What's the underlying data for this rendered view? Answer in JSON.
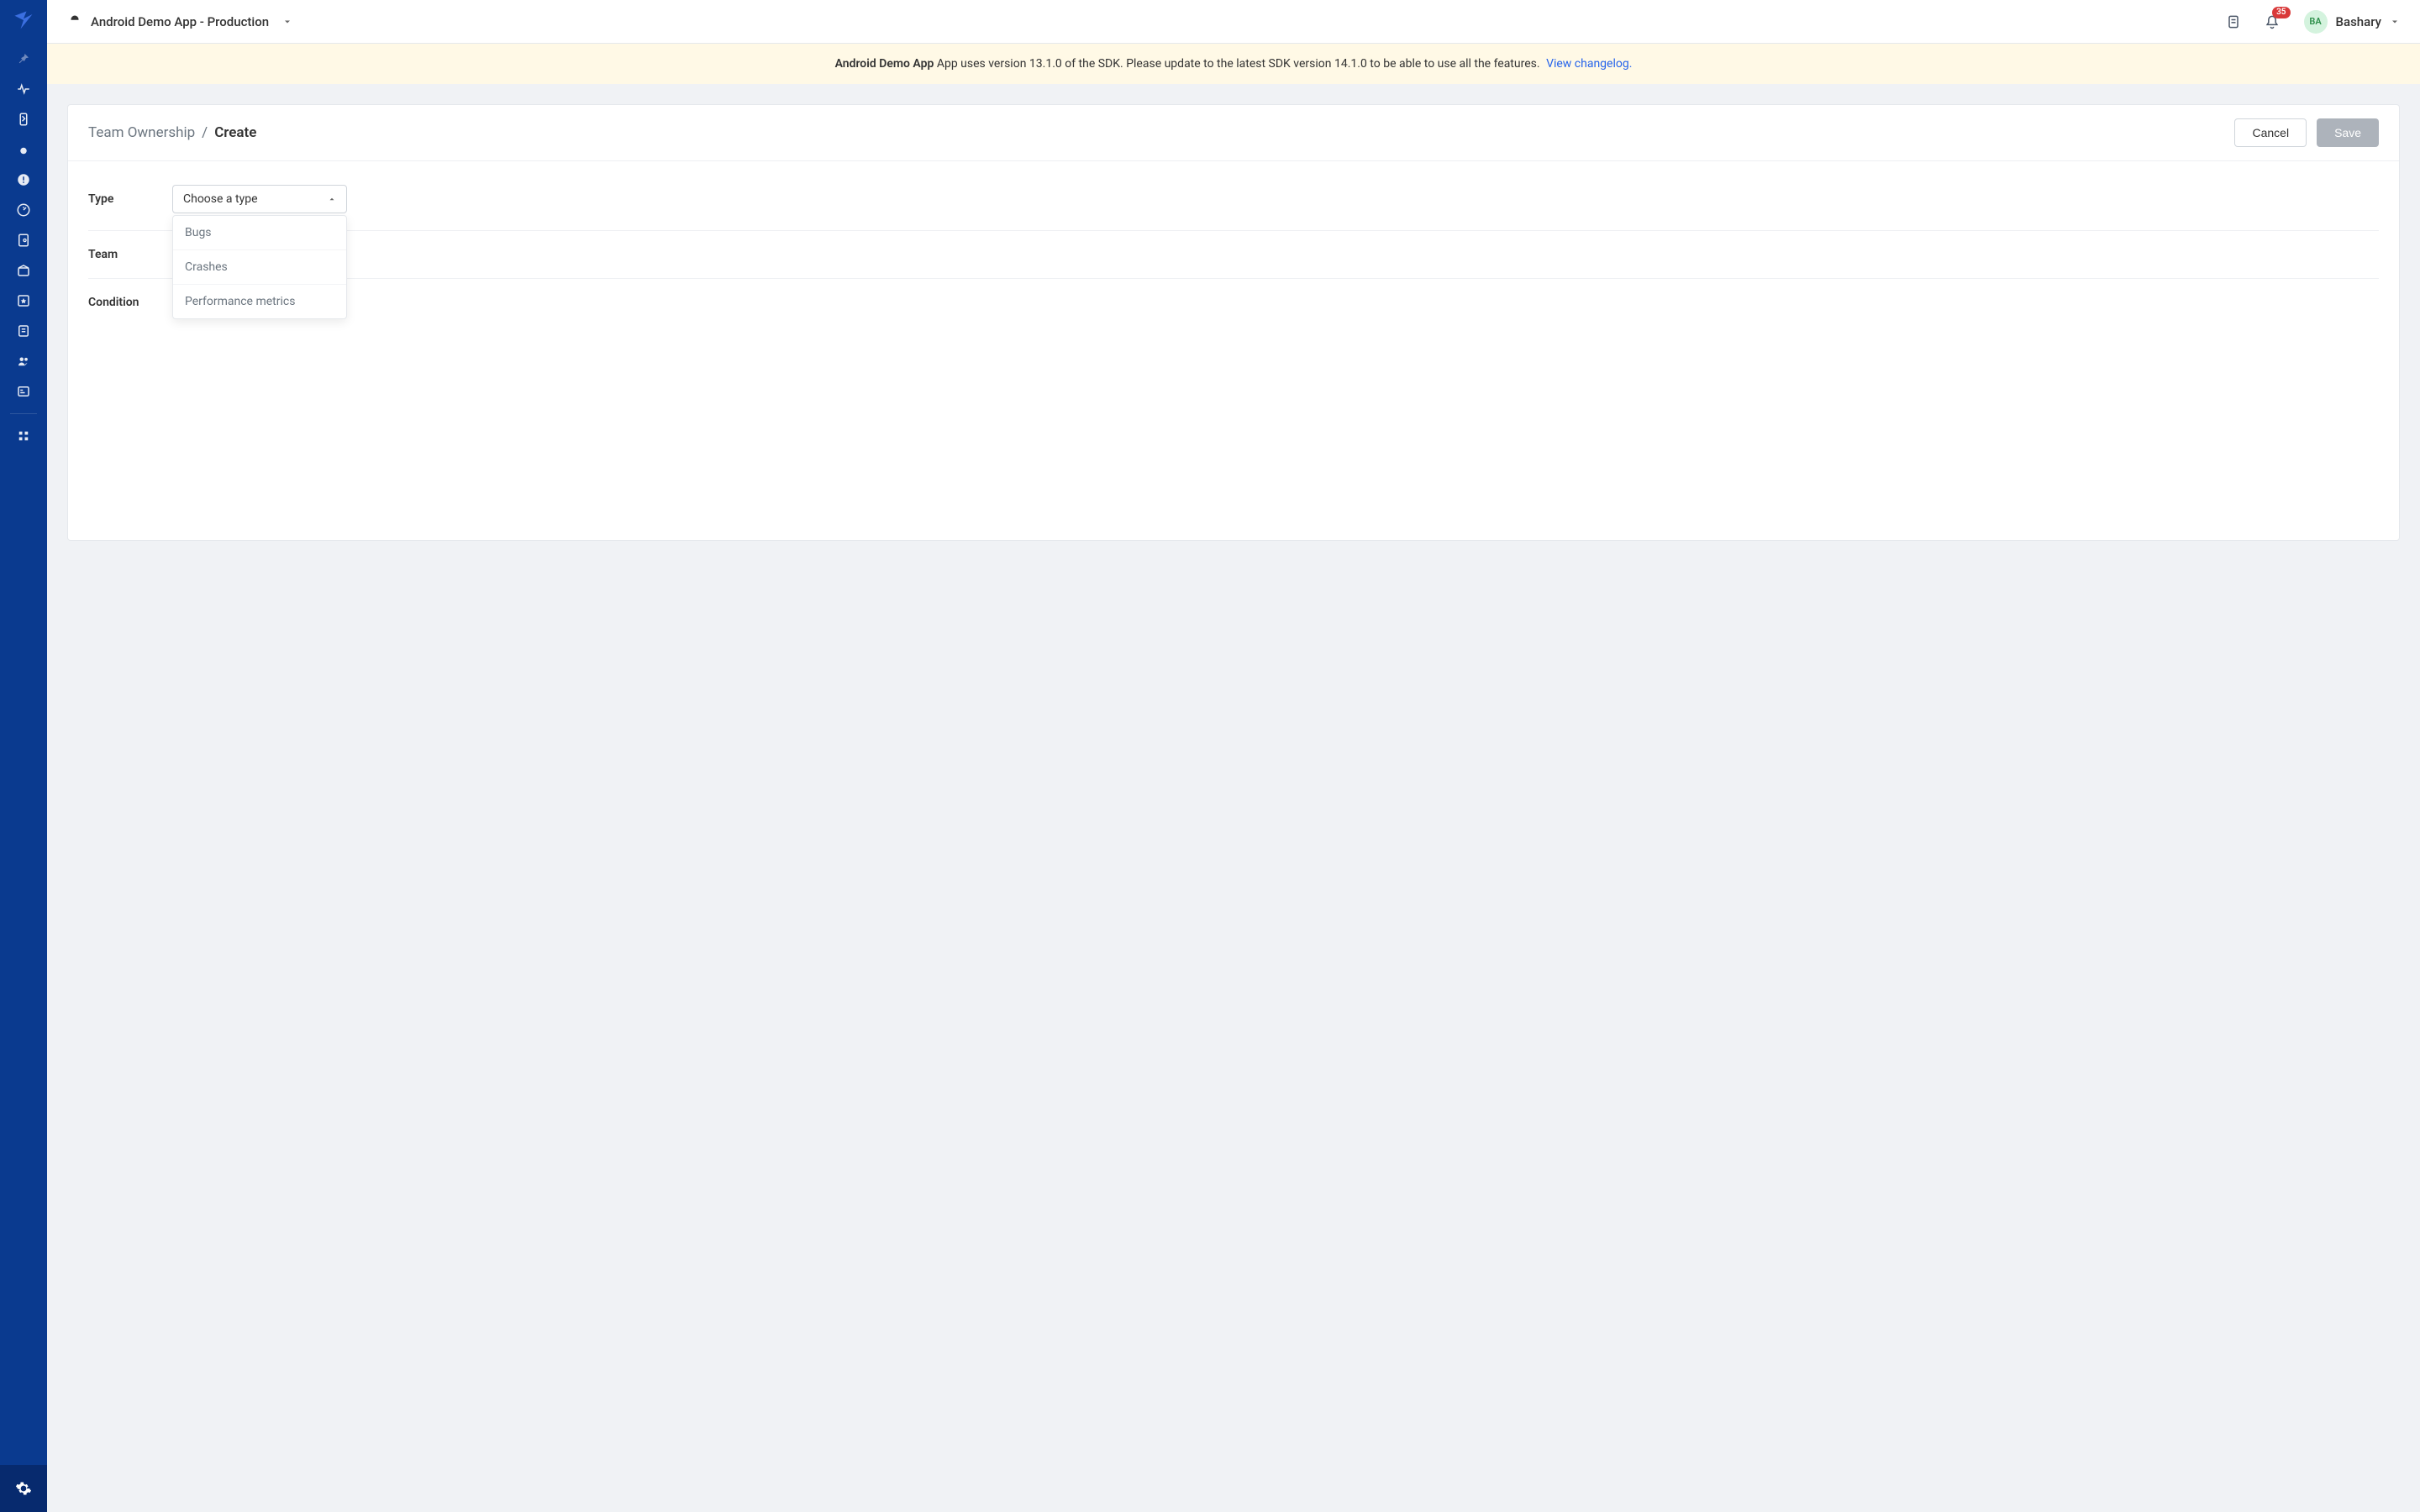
{
  "header": {
    "app_name": "Android Demo App - Production",
    "notification_count": "35",
    "user_initials": "BA",
    "user_name": "Bashary"
  },
  "banner": {
    "app_bold": "Android Demo App",
    "text": " App uses version 13.1.0 of the SDK. Please update to the latest SDK version 14.1.0 to be able to use all the features.",
    "link_text": "View changelog."
  },
  "breadcrumb": {
    "root": "Team Ownership",
    "sep": "/",
    "current": "Create"
  },
  "actions": {
    "cancel": "Cancel",
    "save": "Save"
  },
  "form": {
    "type_label": "Type",
    "team_label": "Team",
    "condition_label": "Condition",
    "type_placeholder": "Choose a type",
    "type_options": [
      "Bugs",
      "Crashes",
      "Performance metrics"
    ]
  }
}
